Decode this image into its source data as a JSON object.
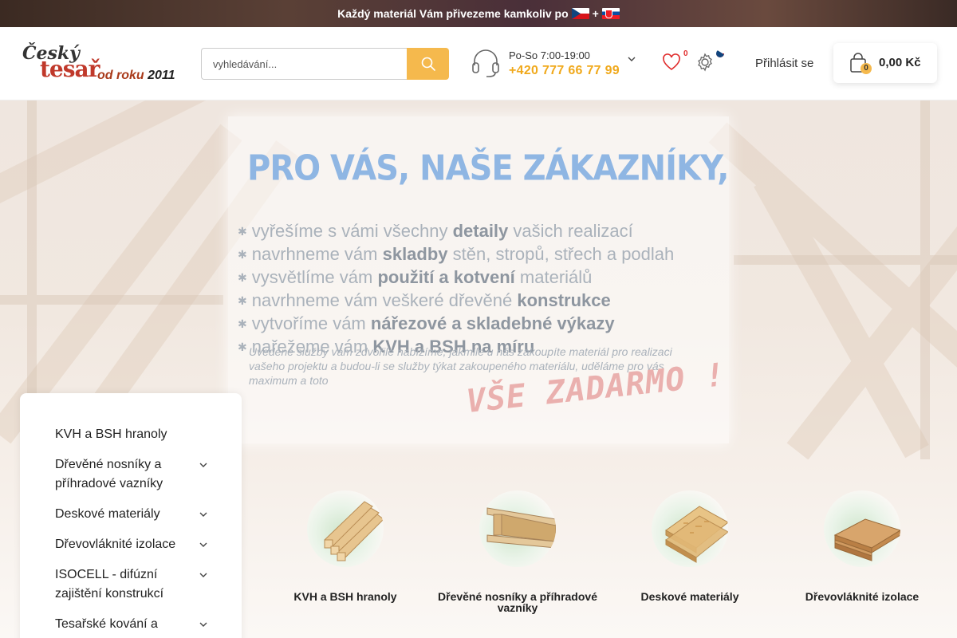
{
  "topbar": {
    "promo": "Každý materiál Vám přivezeme kamkoliv po",
    "plus": "+"
  },
  "logo": {
    "line1": "Český",
    "line2": "tesař",
    "line3": "od roku",
    "year": "2011"
  },
  "search": {
    "placeholder": "vyhledávání..."
  },
  "contact": {
    "hours": "Po-So 7:00-19:00",
    "phone": "+420 777 66 77 99"
  },
  "wishlist": {
    "count": "0"
  },
  "header": {
    "login": "Přihlásit se"
  },
  "cart": {
    "count": "0",
    "total": "0,00 Kč"
  },
  "hero": {
    "title": "PRO VÁS, NAŠE ZÁKAZNÍKY,",
    "items": [
      {
        "pre": "vyřešíme s vámi všechny ",
        "bold": "detaily",
        "post": " vašich realizací"
      },
      {
        "pre": "navrhneme vám ",
        "bold": "skladby",
        "post": " stěn, stropů, střech a podlah"
      },
      {
        "pre": "vysvětlíme vám ",
        "bold": "použití a kotvení",
        "post": " materiálů"
      },
      {
        "pre": "navrhneme vám veškeré dřevěné ",
        "bold": "konstrukce",
        "post": ""
      },
      {
        "pre": "vytvoříme vám ",
        "bold": "nářezové a skladebné výkazy",
        "post": ""
      },
      {
        "pre": "nařežeme vám ",
        "bold": "KVH a BSH na míru",
        "post": ""
      }
    ],
    "note": "Uvedené služby vám zdvořile nabízíme, jakmile u nás zakoupíte materiál pro realizaci vašeho projektu a budou-li se služby týkat zakoupeného materiálu, uděláme pro vás maximum a toto",
    "free": "VŠE ZADARMO !"
  },
  "sidebar": {
    "items": [
      {
        "label": "KVH a BSH hranoly",
        "has_children": false
      },
      {
        "label": "Dřevěné nosníky a příhradové vazníky",
        "has_children": true
      },
      {
        "label": "Deskové materiály",
        "has_children": true
      },
      {
        "label": "Dřevovláknité izolace",
        "has_children": true
      },
      {
        "label": "ISOCELL - difúzní zajištění konstrukcí",
        "has_children": true
      },
      {
        "label": "Tesařské kování a",
        "has_children": true
      }
    ]
  },
  "categories": [
    {
      "label": "KVH a BSH hranoly",
      "icon": "timber-beams-icon"
    },
    {
      "label": "Dřevěné nosníky a příhradové vazníky",
      "icon": "i-beam-icon"
    },
    {
      "label": "Deskové materiály",
      "icon": "osb-boards-icon"
    },
    {
      "label": "Dřevovláknité izolace",
      "icon": "fiberboard-icon"
    }
  ]
}
